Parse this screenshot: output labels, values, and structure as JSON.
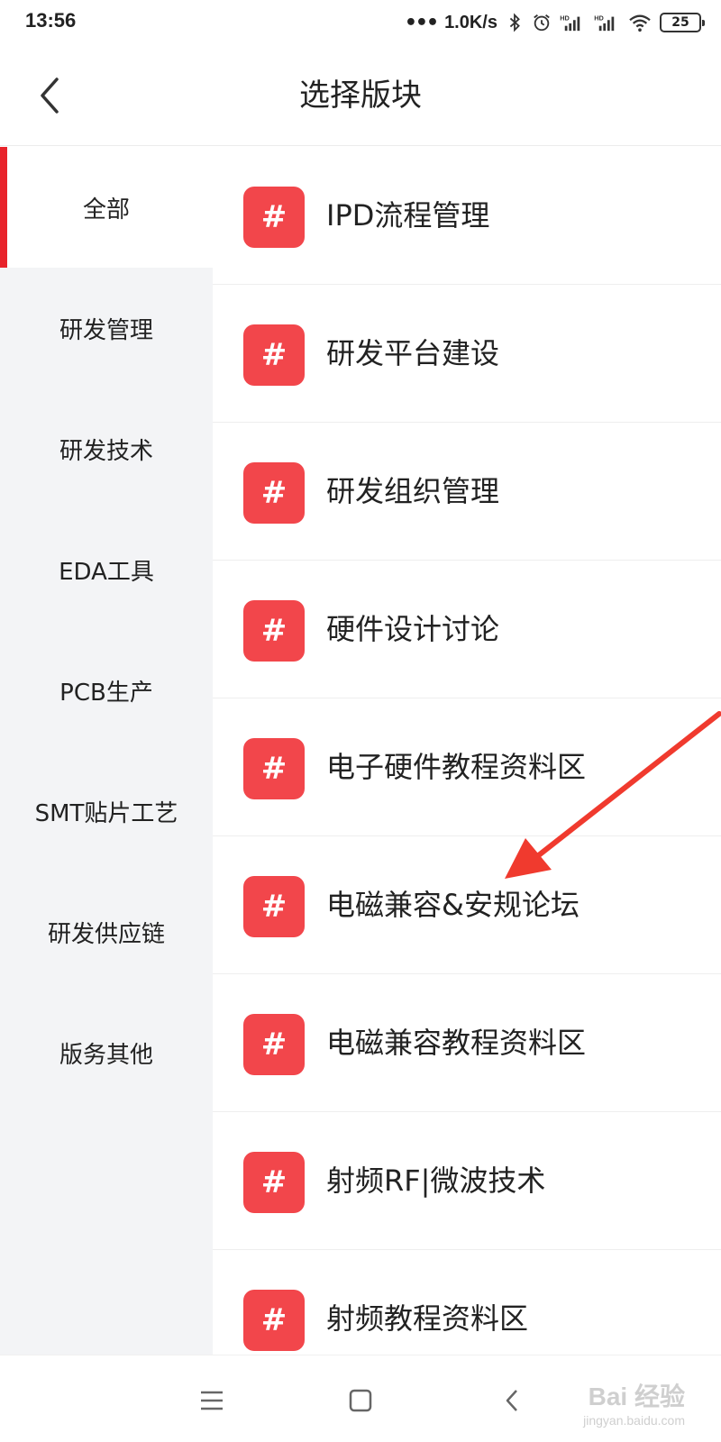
{
  "status_bar": {
    "time": "13:56",
    "dots": "•••",
    "net_speed": "1.0K/s",
    "battery": "25",
    "icons": [
      "bluetooth-icon",
      "alarm-icon",
      "hd-signal-icon",
      "hd-signal-icon",
      "wifi-icon",
      "battery-icon"
    ]
  },
  "header": {
    "title": "选择版块",
    "back_icon": "chevron-left-icon"
  },
  "sidebar": {
    "items": [
      {
        "label": "全部",
        "active": true
      },
      {
        "label": "研发管理",
        "active": false
      },
      {
        "label": "研发技术",
        "active": false
      },
      {
        "label": "EDA工具",
        "active": false
      },
      {
        "label": "PCB生产",
        "active": false
      },
      {
        "label": "SMT贴片工艺",
        "active": false
      },
      {
        "label": "研发供应链",
        "active": false
      },
      {
        "label": "版务其他",
        "active": false
      }
    ],
    "accent_color": "#e8232b"
  },
  "boards": {
    "icon_glyph": "#",
    "icon_color": "#f2464b",
    "items": [
      {
        "label": "IPD流程管理"
      },
      {
        "label": "研发平台建设"
      },
      {
        "label": "研发组织管理"
      },
      {
        "label": "硬件设计讨论"
      },
      {
        "label": "电子硬件教程资料区"
      },
      {
        "label": "电磁兼容&安规论坛"
      },
      {
        "label": "电磁兼容教程资料区"
      },
      {
        "label": "射频RF|微波技术"
      },
      {
        "label": "射频教程资料区"
      }
    ]
  },
  "nav_bar": {
    "buttons": [
      "menu-icon",
      "home-square-icon",
      "back-triangle-icon"
    ]
  },
  "watermark": {
    "main": "Bai 经验",
    "sub": "jingyan.baidu.com"
  }
}
